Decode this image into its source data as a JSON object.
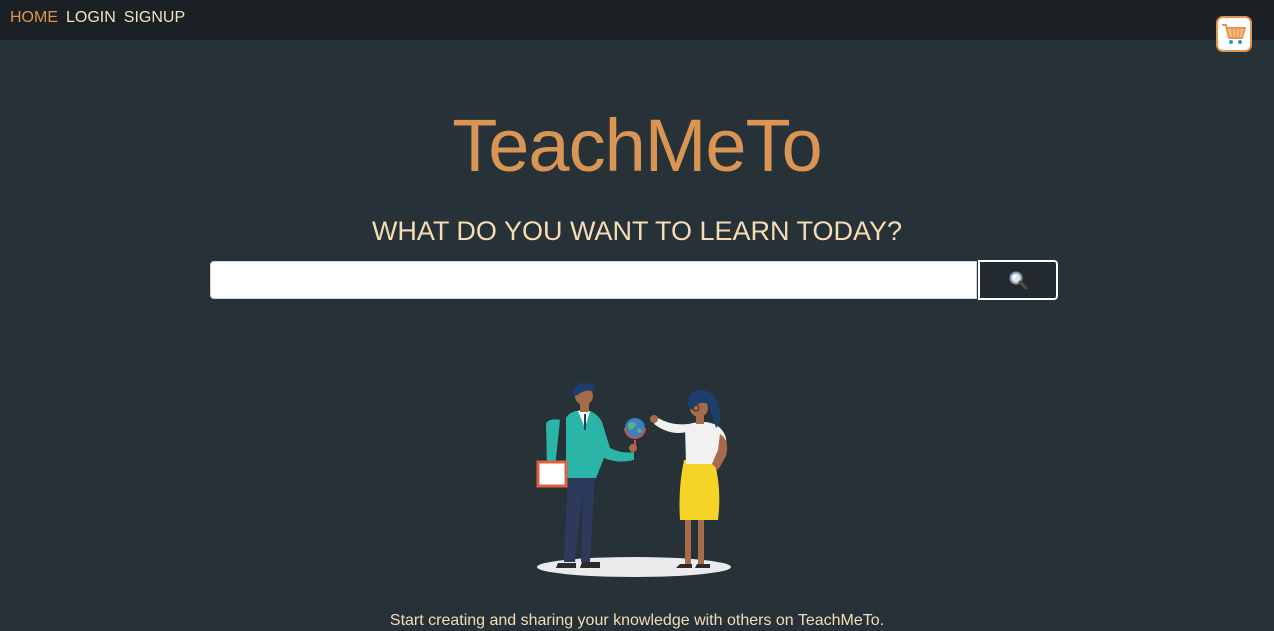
{
  "nav": {
    "links": [
      {
        "label": "HOME",
        "active": true
      },
      {
        "label": "LOGIN",
        "active": false
      },
      {
        "label": "SIGNUP",
        "active": false
      }
    ],
    "cart_icon": "shopping-cart-icon"
  },
  "hero": {
    "title": "TeachMeTo",
    "tagline": "WHAT DO YOU WANT TO LEARN TODAY?"
  },
  "search": {
    "value": "",
    "placeholder": "",
    "button_icon": "magnifying-glass-icon"
  },
  "illustration": {
    "subject": "teachers-with-globe-illustration"
  },
  "footer": {
    "text": "Start creating and sharing your knowledge with others on TeachMeTo."
  },
  "colors": {
    "background": "#263138",
    "navbar": "#1a2024",
    "accent": "#d99553",
    "text_light": "#f6ddb5",
    "cart_border": "#e3954d"
  }
}
